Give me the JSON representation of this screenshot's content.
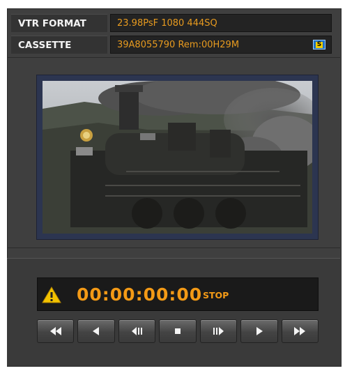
{
  "header": {
    "vtr_format_label": "VTR FORMAT",
    "vtr_format_value": "23.98PsF 1080 444SQ",
    "cassette_label": "CASSETTE",
    "cassette_value": "39A8055790  Rem:00H29M",
    "cassette_badge": "S"
  },
  "transport_display": {
    "timecode": "00:00:00:00",
    "status": "STOP"
  },
  "transport_buttons": [
    {
      "name": "fast-rewind-button",
      "icon": "fast-rewind-icon"
    },
    {
      "name": "rewind-button",
      "icon": "rewind-icon"
    },
    {
      "name": "step-back-button",
      "icon": "step-back-icon"
    },
    {
      "name": "stop-button",
      "icon": "stop-icon"
    },
    {
      "name": "step-forward-button",
      "icon": "step-forward-icon"
    },
    {
      "name": "play-button",
      "icon": "play-icon"
    },
    {
      "name": "fast-forward-button",
      "icon": "fast-forward-icon"
    }
  ],
  "colors": {
    "accent": "#f39a16",
    "panel": "#3f3f3f",
    "badge_blue": "#1e6fc4",
    "badge_yellow": "#f2d000"
  }
}
